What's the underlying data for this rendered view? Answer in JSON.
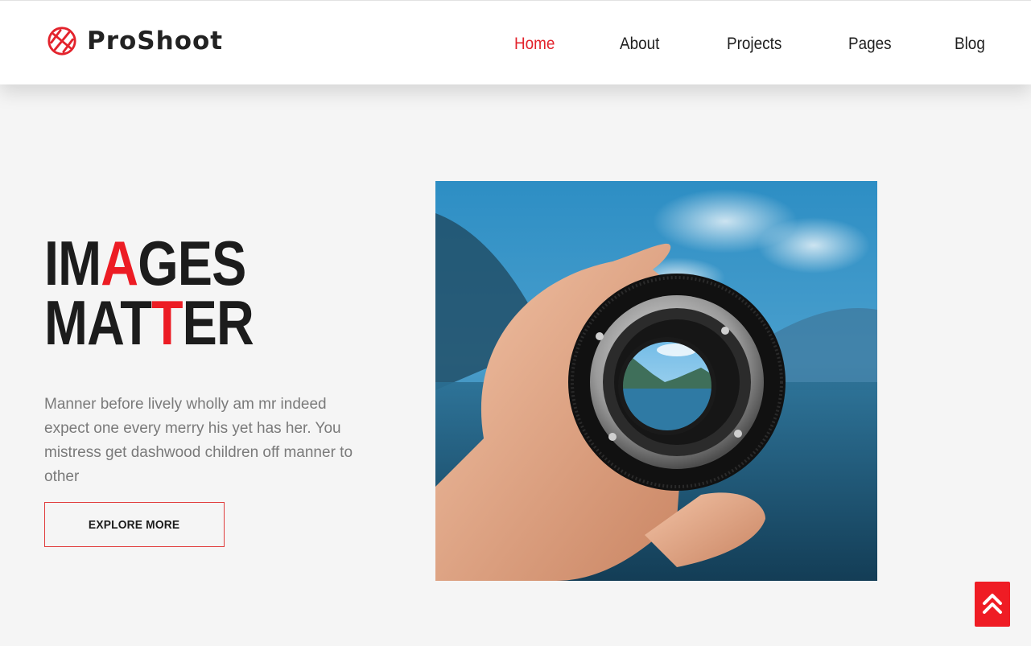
{
  "brand": {
    "name": "ProShoot",
    "accent_color": "#ec1c24",
    "logo_icon": "shutter-icon"
  },
  "nav": {
    "items": [
      {
        "label": "Home",
        "active": true
      },
      {
        "label": "About",
        "active": false
      },
      {
        "label": "Projects",
        "active": false
      },
      {
        "label": "Pages",
        "active": false
      },
      {
        "label": "Blog",
        "active": false
      }
    ]
  },
  "hero": {
    "title_line1": {
      "before": "IM",
      "highlight": "A",
      "after": "GES"
    },
    "title_line2": {
      "before": "MAT",
      "highlight": "T",
      "after": "ER"
    },
    "description": "Manner before lively wholly am mr indeed expect one every merry his yet has her. You mistress get dashwood children off manner to other",
    "button_label": "EXPLORE MORE",
    "image_icon": "camera-lens-photo"
  },
  "scroll_top": {
    "icon": "double-chevron-up-icon"
  }
}
